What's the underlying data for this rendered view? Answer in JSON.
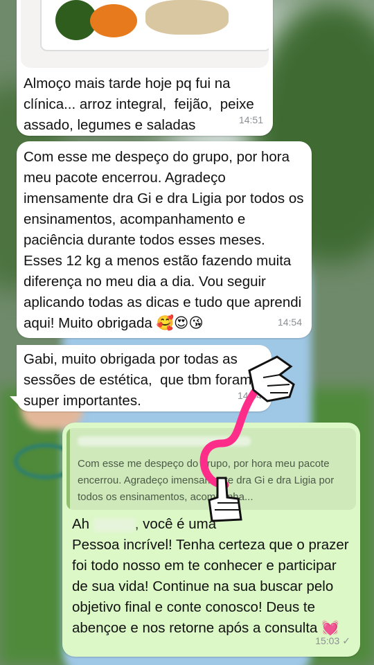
{
  "messages": [
    {
      "text": "Almoço mais tarde hoje pq fui na clínica... arroz integral,  feijão,  peixe assado, legumes e saladas",
      "time": "14:51"
    },
    {
      "text": "Com esse me despeço do grupo, por hora meu pacote encerrou. Agradeço imensamente dra Gi e dra Ligia por todos os ensinamentos, acompanhamento e paciência durante todos esses meses. Esses 12 kg a menos estão fazendo muita diferença no meu dia a dia. Vou seguir aplicando todas as dicas e tudo que aprendi aqui! Muito obrigada 🥰😍😘",
      "time": "14:54"
    },
    {
      "text": "Gabi, muito obrigada por todas as sessões de estética,  que tbm foram super importantes.",
      "time": "14:54"
    }
  ],
  "reply": {
    "quoted_text": "Com esse me despeço do grupo, por hora meu pacote encerrou. Agradeço imensamente dra Gi e dra Ligia por todos os ensinamentos, acompanha...",
    "greeting_start": "Ah ",
    "greeting_end": ", você é uma",
    "body": "Pessoa incrível! Tenha certeza que o prazer foi todo nosso em te conhecer e participar de sua vida! Continue na sua buscar pelo objetivo final e conte conosco! Deus te abençoe e nos retorne após a consulta 💓",
    "time": "15:03",
    "status_icon": "single-check-icon",
    "status_glyph": "✓"
  },
  "colors": {
    "incoming_bubble": "#ffffff",
    "outgoing_bubble": "#dcf8c6",
    "arrow": "#ff2d8a"
  }
}
